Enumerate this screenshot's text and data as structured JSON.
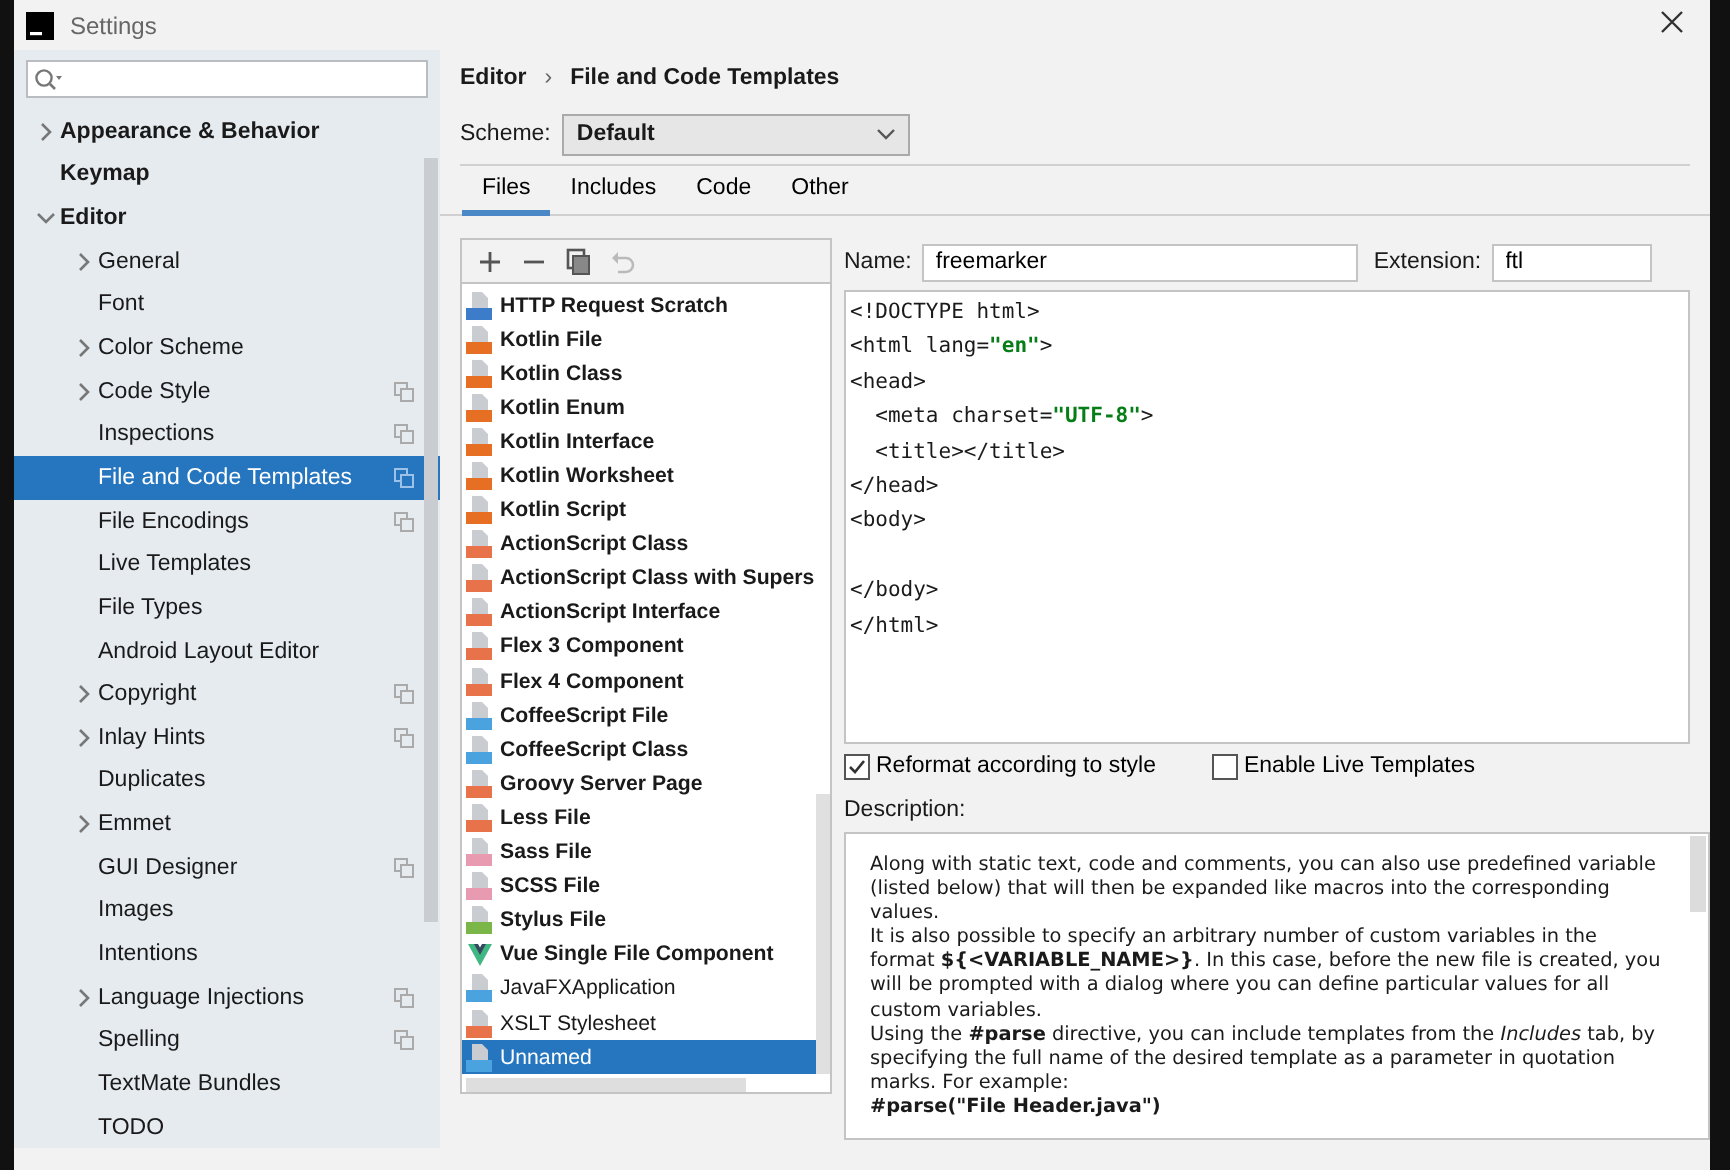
{
  "window": {
    "title": "Settings"
  },
  "sidebar": {
    "items": [
      {
        "label": "Appearance & Behavior",
        "expanded": false
      },
      {
        "label": "Keymap"
      },
      {
        "label": "Editor",
        "expanded": true,
        "children": [
          {
            "label": "General",
            "expanded": false,
            "shared": false,
            "selected": false
          },
          {
            "label": "Font",
            "shared": false,
            "selected": false
          },
          {
            "label": "Color Scheme",
            "expanded": false,
            "shared": false,
            "selected": false
          },
          {
            "label": "Code Style",
            "expanded": false,
            "shared": true,
            "selected": false
          },
          {
            "label": "Inspections",
            "shared": true,
            "selected": false
          },
          {
            "label": "File and Code Templates",
            "shared": true,
            "selected": true
          },
          {
            "label": "File Encodings",
            "shared": true,
            "selected": false
          },
          {
            "label": "Live Templates",
            "shared": false,
            "selected": false
          },
          {
            "label": "File Types",
            "shared": false,
            "selected": false
          },
          {
            "label": "Android Layout Editor",
            "shared": false,
            "selected": false
          },
          {
            "label": "Copyright",
            "expanded": false,
            "shared": true,
            "selected": false
          },
          {
            "label": "Inlay Hints",
            "expanded": false,
            "shared": true,
            "selected": false
          },
          {
            "label": "Duplicates",
            "shared": false,
            "selected": false
          },
          {
            "label": "Emmet",
            "expanded": false,
            "shared": false,
            "selected": false
          },
          {
            "label": "GUI Designer",
            "shared": true,
            "selected": false
          },
          {
            "label": "Images",
            "shared": false,
            "selected": false
          },
          {
            "label": "Intentions",
            "shared": false,
            "selected": false
          },
          {
            "label": "Language Injections",
            "expanded": false,
            "shared": true,
            "selected": false
          },
          {
            "label": "Spelling",
            "shared": true,
            "selected": false
          },
          {
            "label": "TextMate Bundles",
            "shared": false,
            "selected": false
          },
          {
            "label": "TODO",
            "shared": false,
            "selected": false
          }
        ]
      }
    ]
  },
  "breadcrumb": {
    "parent": "Editor",
    "separator": "›",
    "current": "File and Code Templates"
  },
  "scheme": {
    "label": "Scheme:",
    "value": "Default"
  },
  "tabs": [
    {
      "label": "Files",
      "selected": true
    },
    {
      "label": "Includes",
      "selected": false
    },
    {
      "label": "Code",
      "selected": false
    },
    {
      "label": "Other",
      "selected": false
    }
  ],
  "toolbar": [
    {
      "kind": "add",
      "disabled": false
    },
    {
      "kind": "remove",
      "disabled": false
    },
    {
      "kind": "copy",
      "disabled": false
    },
    {
      "kind": "reset",
      "disabled": true
    }
  ],
  "templates": [
    {
      "name": "HTTP Request Scratch",
      "kind": "api",
      "bold": true,
      "selected": false
    },
    {
      "name": "Kotlin File",
      "kind": "kotlin",
      "bold": true,
      "selected": false
    },
    {
      "name": "Kotlin Class",
      "kind": "kotlin",
      "bold": true,
      "selected": false
    },
    {
      "name": "Kotlin Enum",
      "kind": "kotlin",
      "bold": true,
      "selected": false
    },
    {
      "name": "Kotlin Interface",
      "kind": "kotlin",
      "bold": true,
      "selected": false
    },
    {
      "name": "Kotlin Worksheet",
      "kind": "kotlin",
      "bold": true,
      "selected": false
    },
    {
      "name": "Kotlin Script",
      "kind": "kotlin",
      "bold": true,
      "selected": false
    },
    {
      "name": "ActionScript Class",
      "kind": "actionscript",
      "bold": true,
      "selected": false
    },
    {
      "name": "ActionScript Class with Supers",
      "kind": "actionscript",
      "bold": true,
      "selected": false
    },
    {
      "name": "ActionScript Interface",
      "kind": "actionscript",
      "bold": true,
      "selected": false
    },
    {
      "name": "Flex 3 Component",
      "kind": "flex",
      "bold": true,
      "selected": false
    },
    {
      "name": "Flex 4 Component",
      "kind": "flex",
      "bold": true,
      "selected": false
    },
    {
      "name": "CoffeeScript File",
      "kind": "coffee",
      "bold": true,
      "selected": false
    },
    {
      "name": "CoffeeScript Class",
      "kind": "coffee",
      "bold": true,
      "selected": false
    },
    {
      "name": "Groovy Server Page",
      "kind": "gsp",
      "bold": true,
      "selected": false
    },
    {
      "name": "Less File",
      "kind": "less",
      "bold": true,
      "selected": false
    },
    {
      "name": "Sass File",
      "kind": "sass",
      "bold": true,
      "selected": false
    },
    {
      "name": "SCSS File",
      "kind": "sass",
      "bold": true,
      "selected": false
    },
    {
      "name": "Stylus File",
      "kind": "stylus",
      "bold": true,
      "selected": false
    },
    {
      "name": "Vue Single File Component",
      "kind": "vue",
      "bold": true,
      "selected": false
    },
    {
      "name": "JavaFXApplication",
      "kind": "java",
      "bold": false,
      "selected": false
    },
    {
      "name": "XSLT Stylesheet",
      "kind": "flex",
      "bold": false,
      "selected": false
    },
    {
      "name": "Unnamed",
      "kind": "java",
      "bold": false,
      "selected": true
    }
  ],
  "name_field": {
    "label": "Name:",
    "value": "freemarker"
  },
  "extension_field": {
    "label": "Extension:",
    "value": "ftl"
  },
  "code": [
    [
      {
        "text": "<!DOCTYPE html>",
        "kind": "tag"
      }
    ],
    [
      {
        "text": "<html lang=",
        "kind": "tag"
      },
      {
        "text": "\"en\"",
        "kind": "string"
      },
      {
        "text": ">",
        "kind": "tag"
      }
    ],
    [
      {
        "text": "<head>",
        "kind": "tag"
      }
    ],
    [
      {
        "text": "  <meta charset=",
        "kind": "tag"
      },
      {
        "text": "\"UTF-8\"",
        "kind": "string"
      },
      {
        "text": ">",
        "kind": "tag"
      }
    ],
    [
      {
        "text": "  <title></title>",
        "kind": "tag"
      }
    ],
    [
      {
        "text": "</head>",
        "kind": "tag"
      }
    ],
    [
      {
        "text": "<body>",
        "kind": "tag"
      }
    ],
    [
      {
        "kind": "blank"
      }
    ],
    [
      {
        "text": "</body>",
        "kind": "tag"
      }
    ],
    [
      {
        "text": "</html>",
        "kind": "tag"
      }
    ]
  ],
  "options": [
    {
      "label": "Reformat according to style",
      "checked": true
    },
    {
      "label": "Enable Live Templates",
      "checked": false
    }
  ],
  "description": {
    "label": "Description:",
    "lines": [
      "Along with static text, code and comments, you can also use predefined variable",
      "(listed below) that will then be expanded like macros into the corresponding",
      "values.",
      "It is also possible to specify an arbitrary number of custom variables in the",
      "format **${<VARIABLE_NAME>}**. In this case, before the new file is created, you",
      "will be prompted with a dialog where you can define particular values for all",
      "custom variables.",
      "Using the **#parse** directive, you can include templates from the *Includes* tab, by",
      "specifying the full name of the desired template as a parameter in quotation",
      "marks. For example:",
      "**#parse(\"File Header.java\")**"
    ]
  }
}
